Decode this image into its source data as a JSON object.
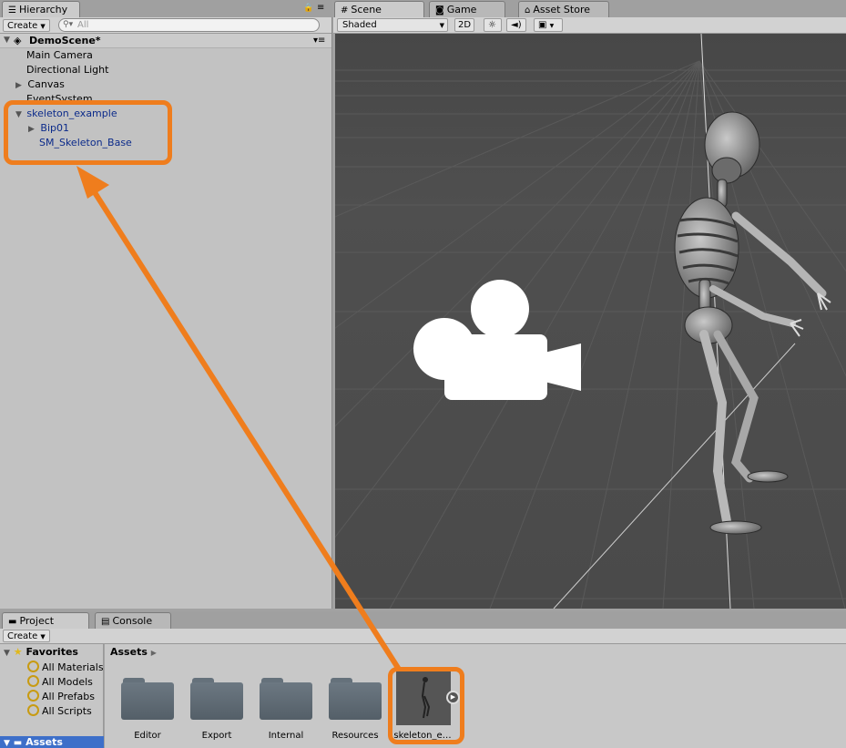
{
  "colors": {
    "highlight": "#ef7d1d",
    "selection_blue": "#3d6fc9",
    "viewport_bg": "#4a4a4a"
  },
  "hierarchy": {
    "tab_label": "Hierarchy",
    "create_label": "Create",
    "search_placeholder": "All",
    "scene_name": "DemoScene*",
    "items": [
      {
        "label": "Main Camera"
      },
      {
        "label": "Directional Light"
      },
      {
        "label": "Canvas"
      },
      {
        "label": "EventSystem"
      },
      {
        "label": "skeleton_example"
      },
      {
        "label": "Bip01"
      },
      {
        "label": "SM_Skeleton_Base"
      }
    ]
  },
  "scene": {
    "tabs": [
      {
        "label": "Scene",
        "icon": "grid-icon"
      },
      {
        "label": "Game",
        "icon": "game-icon"
      },
      {
        "label": "Asset Store",
        "icon": "store-icon"
      }
    ],
    "shading_mode": "Shaded",
    "mode_2d": "2D"
  },
  "project": {
    "tabs": [
      {
        "label": "Project",
        "icon": "folder-icon"
      },
      {
        "label": "Console",
        "icon": "console-icon"
      }
    ],
    "create_label": "Create",
    "favorites_label": "Favorites",
    "favorites": [
      {
        "label": "All Materials"
      },
      {
        "label": "All Models"
      },
      {
        "label": "All Prefabs"
      },
      {
        "label": "All Scripts"
      }
    ],
    "assets_label": "Assets",
    "breadcrumb": "Assets",
    "assets": [
      {
        "label": "Editor"
      },
      {
        "label": "Export"
      },
      {
        "label": "Internal"
      },
      {
        "label": "Resources"
      },
      {
        "label": "skeleton_e…"
      }
    ]
  }
}
